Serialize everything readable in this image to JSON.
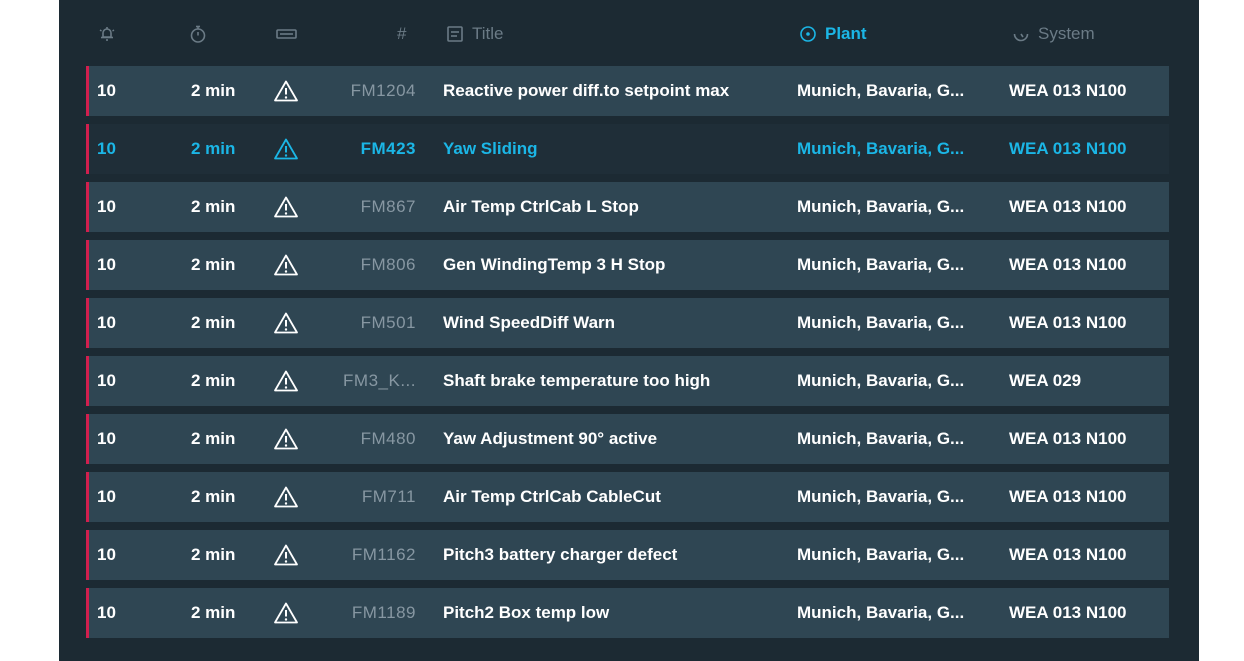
{
  "header": {
    "priority_icon": "bell-icon",
    "time_icon": "stopwatch-icon",
    "type_icon": "battery-icon",
    "number_label": "#",
    "title_label": "Title",
    "plant_label": "Plant",
    "system_label": "System"
  },
  "colors": {
    "background": "#1c2a33",
    "row": "#2f4653",
    "selected_row": "#1f2e38",
    "accent": "#1bb6e6",
    "alarm_bar": "#d11f4e",
    "muted": "#8797a2"
  },
  "rows": [
    {
      "priority": "10",
      "time": "2 min",
      "icon": "warning-icon",
      "number": "FM1204",
      "title": "Reactive power diff.to setpoint max",
      "plant": "Munich, Bavaria, G...",
      "system": "WEA 013 N100",
      "selected": false
    },
    {
      "priority": "10",
      "time": "2 min",
      "icon": "warning-icon",
      "number": "FM423",
      "title": "Yaw Sliding",
      "plant": "Munich, Bavaria, G...",
      "system": "WEA 013 N100",
      "selected": true
    },
    {
      "priority": "10",
      "time": "2 min",
      "icon": "warning-icon",
      "number": "FM867",
      "title": "Air Temp CtrlCab L Stop",
      "plant": "Munich, Bavaria, G...",
      "system": "WEA 013 N100",
      "selected": false
    },
    {
      "priority": "10",
      "time": "2 min",
      "icon": "warning-icon",
      "number": "FM806",
      "title": "Gen WindingTemp 3 H Stop",
      "plant": "Munich, Bavaria, G...",
      "system": "WEA 013 N100",
      "selected": false
    },
    {
      "priority": "10",
      "time": "2 min",
      "icon": "warning-icon",
      "number": "FM501",
      "title": "Wind SpeedDiff Warn",
      "plant": "Munich, Bavaria, G...",
      "system": "WEA 013 N100",
      "selected": false
    },
    {
      "priority": "10",
      "time": "2 min",
      "icon": "warning-icon",
      "number": "FM3_K...",
      "title": "Shaft brake temperature too high",
      "plant": "Munich, Bavaria, G...",
      "system": "WEA 029",
      "selected": false
    },
    {
      "priority": "10",
      "time": "2 min",
      "icon": "warning-icon",
      "number": "FM480",
      "title": "Yaw Adjustment 90° active",
      "plant": "Munich, Bavaria, G...",
      "system": "WEA 013 N100",
      "selected": false
    },
    {
      "priority": "10",
      "time": "2 min",
      "icon": "warning-icon",
      "number": "FM711",
      "title": "Air Temp CtrlCab CableCut",
      "plant": "Munich, Bavaria, G...",
      "system": "WEA 013 N100",
      "selected": false
    },
    {
      "priority": "10",
      "time": "2 min",
      "icon": "warning-icon",
      "number": "FM1162",
      "title": "Pitch3 battery charger defect",
      "plant": "Munich, Bavaria, G...",
      "system": "WEA 013 N100",
      "selected": false
    },
    {
      "priority": "10",
      "time": "2 min",
      "icon": "warning-icon",
      "number": "FM1189",
      "title": "Pitch2 Box temp low",
      "plant": "Munich, Bavaria, G...",
      "system": "WEA 013 N100",
      "selected": false
    }
  ]
}
